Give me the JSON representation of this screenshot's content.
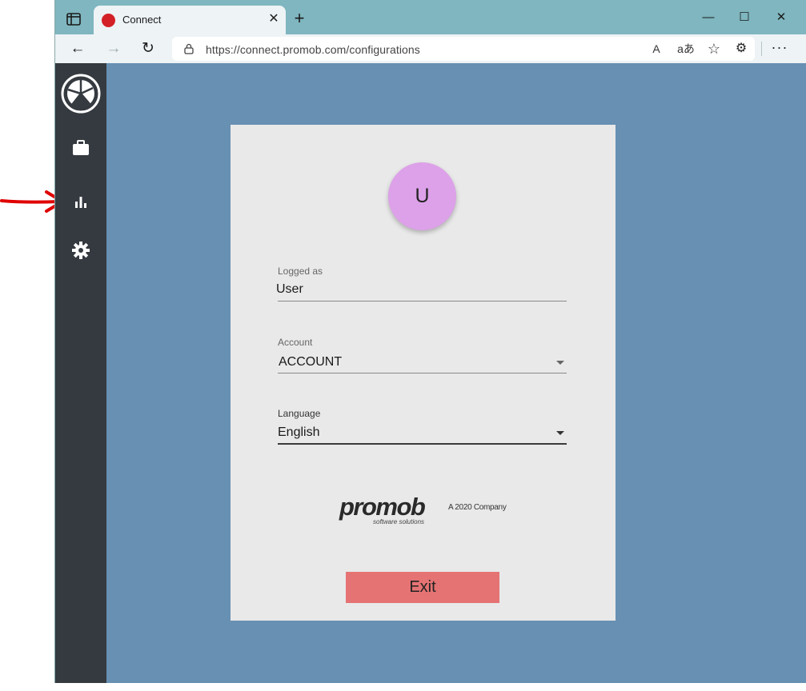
{
  "browser": {
    "tab_title": "Connect",
    "tab_close_glyph": "✕",
    "new_tab_glyph": "+",
    "window_controls": {
      "minimize": "—",
      "maximize": "☐",
      "close": "✕"
    },
    "url": "https://connect.promob.com/configurations",
    "nav": {
      "back": "←",
      "forward": "→",
      "reload": "↻"
    },
    "address_icons": {
      "read_aloud": "A",
      "translate": "aあ",
      "favorite": "☆"
    },
    "extensions_glyph": "⚙",
    "menu_glyph": "···"
  },
  "sidebar": {
    "items": [
      {
        "icon": "briefcase-icon"
      },
      {
        "icon": "bar-chart-icon"
      },
      {
        "icon": "gear-icon"
      }
    ]
  },
  "profile": {
    "avatar_initial": "U",
    "logged_as_label": "Logged as",
    "logged_as_value": "User",
    "account_label": "Account",
    "account_value": "ACCOUNT",
    "language_label": "Language",
    "language_value": "English"
  },
  "brand": {
    "name": "promob",
    "subtitle": "software solutions",
    "tagline": "A 2020 Company"
  },
  "exit_label": "Exit",
  "colors": {
    "titlebar": "#7fb6bf",
    "sidebar": "#353a40",
    "background": "#6790b3",
    "card": "#e9e9e9",
    "avatar": "#dca1e8",
    "exit": "#e57373",
    "annotation_arrow": "#e00000"
  }
}
